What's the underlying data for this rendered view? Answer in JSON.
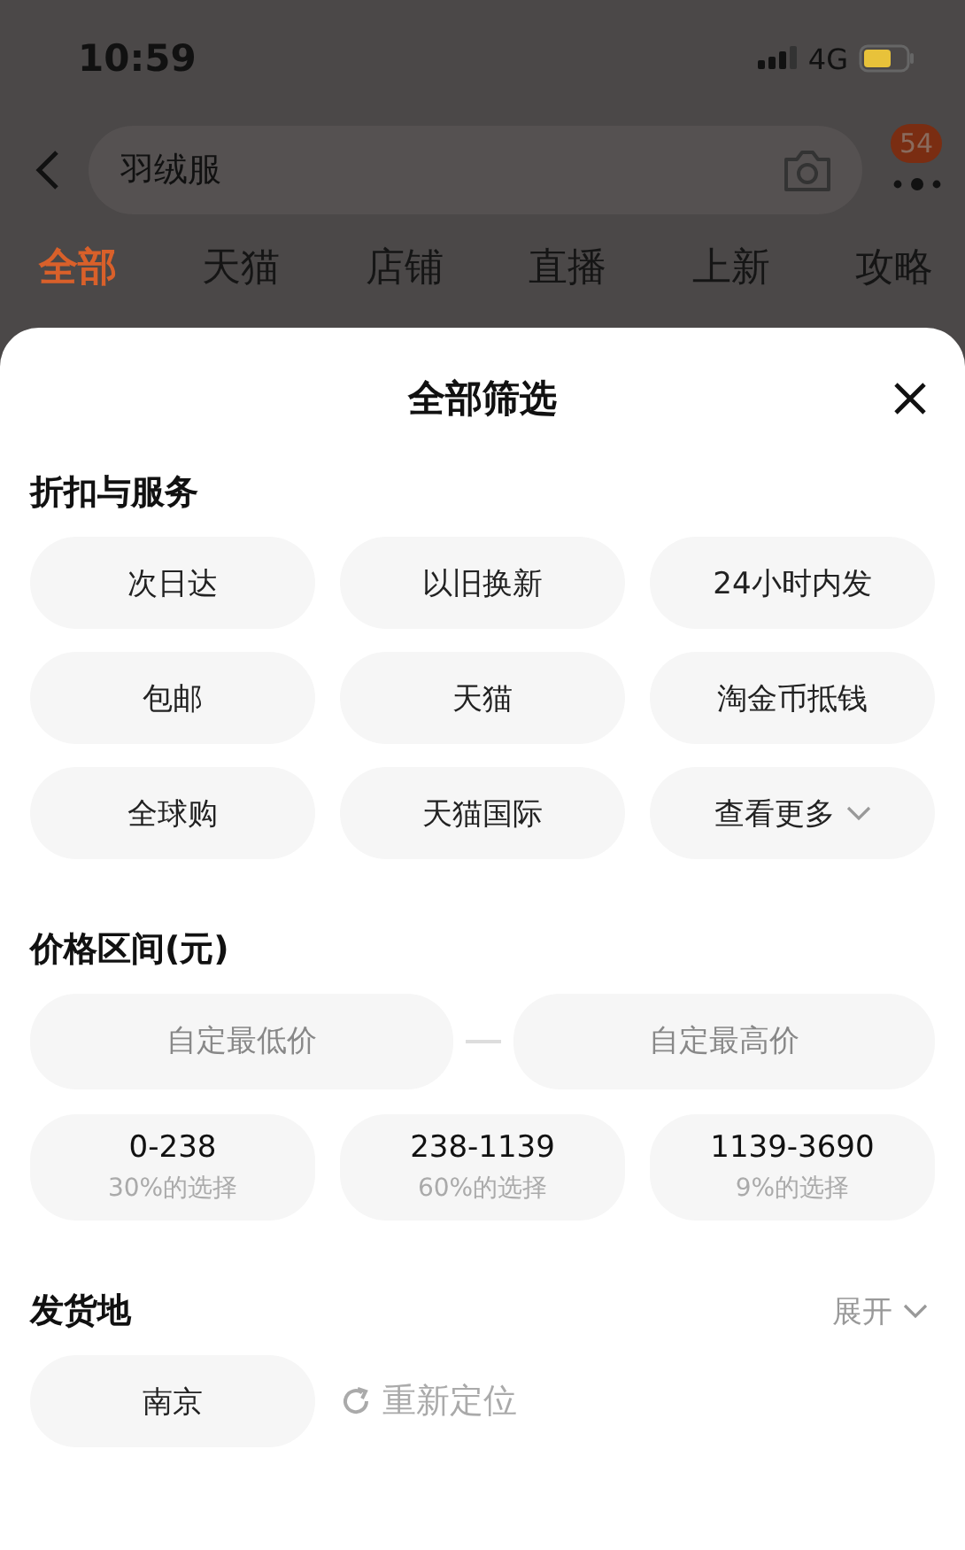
{
  "status_bar": {
    "time": "10:59",
    "network": "4G"
  },
  "search": {
    "value": "羽绒服",
    "badge": "54"
  },
  "tabs": [
    {
      "label": "全部",
      "selected": true
    },
    {
      "label": "天猫",
      "selected": false
    },
    {
      "label": "店铺",
      "selected": false
    },
    {
      "label": "直播",
      "selected": false
    },
    {
      "label": "上新",
      "selected": false
    },
    {
      "label": "攻略",
      "selected": false
    }
  ],
  "sheet": {
    "title": "全部筛选",
    "services": {
      "heading": "折扣与服务",
      "options": [
        {
          "kind": "option",
          "label": "次日达"
        },
        {
          "kind": "option",
          "label": "以旧换新"
        },
        {
          "kind": "option",
          "label": "24小时内发"
        },
        {
          "kind": "option",
          "label": "包邮"
        },
        {
          "kind": "option",
          "label": "天猫"
        },
        {
          "kind": "option",
          "label": "淘金币抵钱"
        },
        {
          "kind": "option",
          "label": "全球购"
        },
        {
          "kind": "option",
          "label": "天猫国际"
        },
        {
          "kind": "more",
          "label": "查看更多"
        }
      ]
    },
    "price": {
      "heading": "价格区间(元)",
      "min_placeholder": "自定最低价",
      "max_placeholder": "自定最高价",
      "ranges": [
        {
          "range": "0-238",
          "share": "30%的选择"
        },
        {
          "range": "238-1139",
          "share": "60%的选择"
        },
        {
          "range": "1139-3690",
          "share": "9%的选择"
        }
      ]
    },
    "origin": {
      "heading": "发货地",
      "expand": "展开",
      "location": "南京",
      "relocate": "重新定位"
    }
  }
}
